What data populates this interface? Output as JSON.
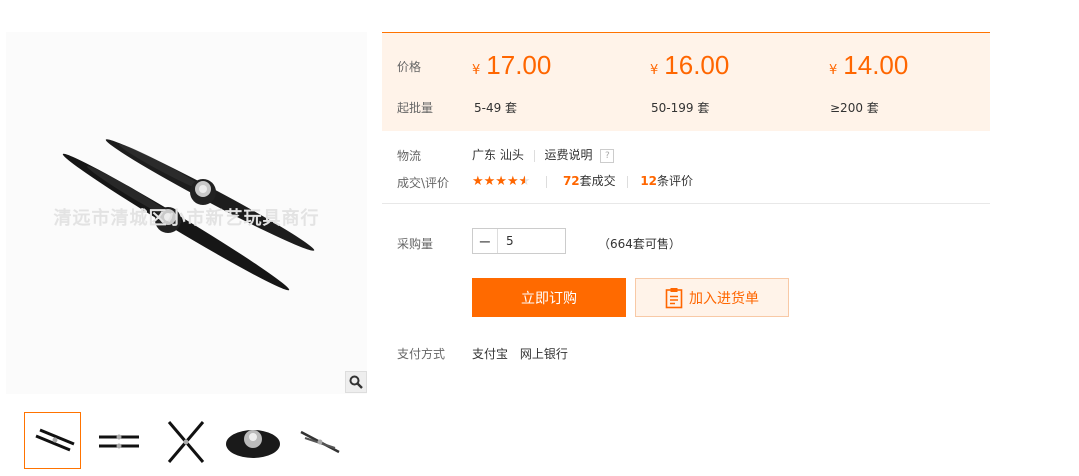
{
  "gallery": {
    "watermark": "清远市清城区小市新艺玩具商行",
    "thumb_count": 5
  },
  "pricing": {
    "price_label": "价格",
    "moq_label": "起批量",
    "currency": "¥",
    "tiers": [
      {
        "price": "17.00",
        "range": "5-49 套"
      },
      {
        "price": "16.00",
        "range": "50-199 套"
      },
      {
        "price": "14.00",
        "range": "≥200 套"
      }
    ]
  },
  "logistics": {
    "label": "物流",
    "location": "广东 汕头",
    "shipping_link": "运费说明",
    "help_glyph": "?"
  },
  "deals": {
    "label": "成交\\评价",
    "rating_stars": 4.5,
    "sold_count": "72",
    "sold_suffix": "套成交",
    "review_count": "12",
    "review_suffix": "条评价"
  },
  "purchase": {
    "label": "采购量",
    "quantity": "5",
    "minus_glyph": "−",
    "stock_text": "（664套可售）",
    "buy_button": "立即订购",
    "cart_button": "加入进货单"
  },
  "payment": {
    "label": "支付方式",
    "methods": [
      "支付宝",
      "网上银行"
    ]
  },
  "colors": {
    "accent": "#ff6a00",
    "price_bg": "#fff3e9"
  }
}
